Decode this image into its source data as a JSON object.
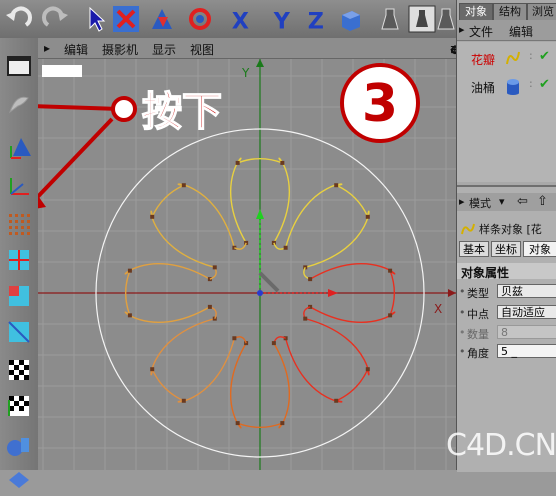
{
  "viewport_menu": {
    "items": [
      "编辑",
      "摄影机",
      "显示",
      "视图"
    ],
    "icons": [
      "move-icon",
      "rotate-icon",
      "scale-icon",
      "maximize-icon"
    ]
  },
  "viewport": {
    "axis_x_label": "X",
    "axis_y_label": "Y",
    "annotation_text": "按下",
    "step_number": "3",
    "watermark": "C4D.CN"
  },
  "toolbar_icons": [
    "undo-icon",
    "redo-icon",
    "select-arrow-icon",
    "move-icon",
    "scale-icon",
    "rotate-icon",
    "x-axis-lock-icon",
    "y-axis-lock-icon",
    "z-axis-lock-icon",
    "world-coordinates-icon",
    "render-view-icon",
    "render-picture-icon",
    "render-settings-icon"
  ],
  "toolbar_labels": {
    "x": "X",
    "y": "Y",
    "z": "Z"
  },
  "left_icons": [
    "view-layout-icon",
    "model-mode-icon",
    "object-axis-icon",
    "points-mode-icon",
    "edges-mode-icon",
    "polygons-mode-icon",
    "texture-mode-icon",
    "uv-mode-icon",
    "checker-icon",
    "checker-alt-icon",
    "paint-icon",
    "workplane-icon"
  ],
  "object_manager": {
    "tabs": [
      "对象",
      "结构",
      "浏览"
    ],
    "menu": [
      "文件",
      "编辑"
    ],
    "objects": [
      {
        "name": "花瓣",
        "color": "#cc0000"
      },
      {
        "name": "油桶",
        "color": "#111111"
      }
    ]
  },
  "attribute_manager": {
    "header": "模式",
    "title": "样条对象 [花",
    "tabs": [
      "基本",
      "坐标",
      "对象"
    ],
    "section": "对象属性",
    "fields": [
      {
        "label": "类型",
        "value": "贝兹"
      },
      {
        "label": "中点",
        "value": "自动适应"
      },
      {
        "label": "数量",
        "value": "8"
      },
      {
        "label": "角度",
        "value": "5 _"
      }
    ]
  }
}
